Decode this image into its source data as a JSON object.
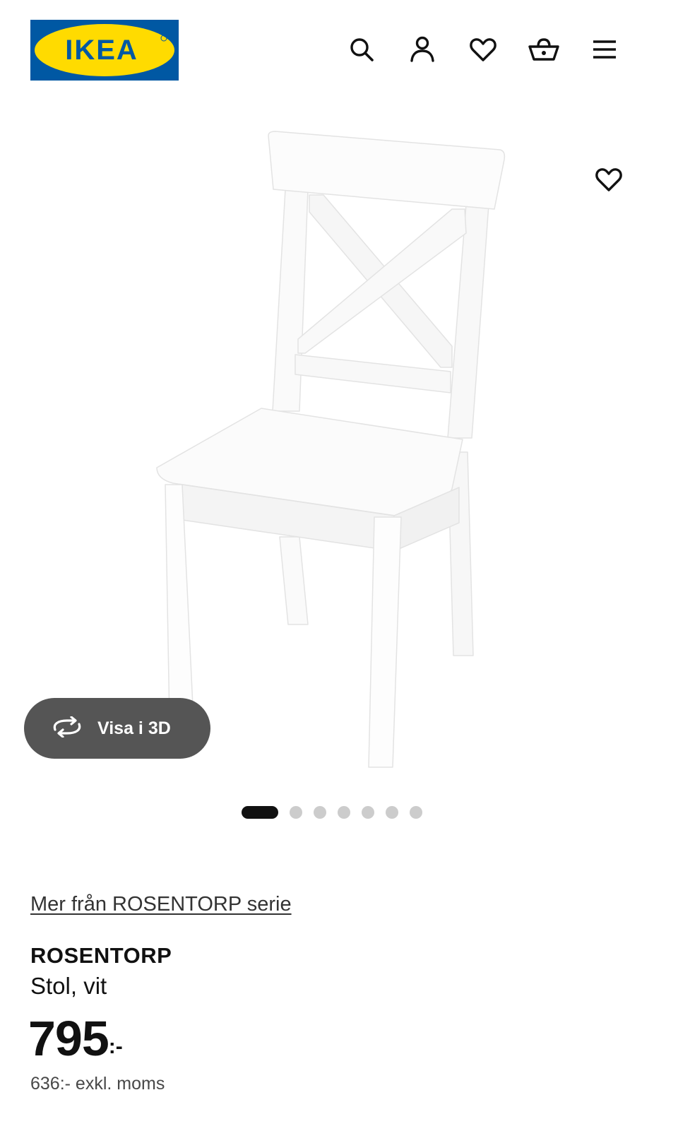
{
  "header": {
    "logo_text": "IKEA",
    "icons": [
      "search-icon",
      "user-icon",
      "heart-icon",
      "basket-icon",
      "menu-icon"
    ]
  },
  "gallery": {
    "view_3d_label": "Visa i 3D",
    "active_slide": 1,
    "slide_count": 7
  },
  "product": {
    "series_link": "Mer från ROSENTORP serie",
    "name": "ROSENTORP",
    "description": "Stol, vit",
    "price_integer": "795",
    "price_suffix": ":-",
    "price_excl_vat": "636:- exkl. moms"
  },
  "colors": {
    "brand_blue": "#0058a3",
    "brand_yellow": "#ffdb00",
    "button_3d_bg": "#555555",
    "dot_active": "#111111",
    "dot_inactive": "#cccccc"
  }
}
